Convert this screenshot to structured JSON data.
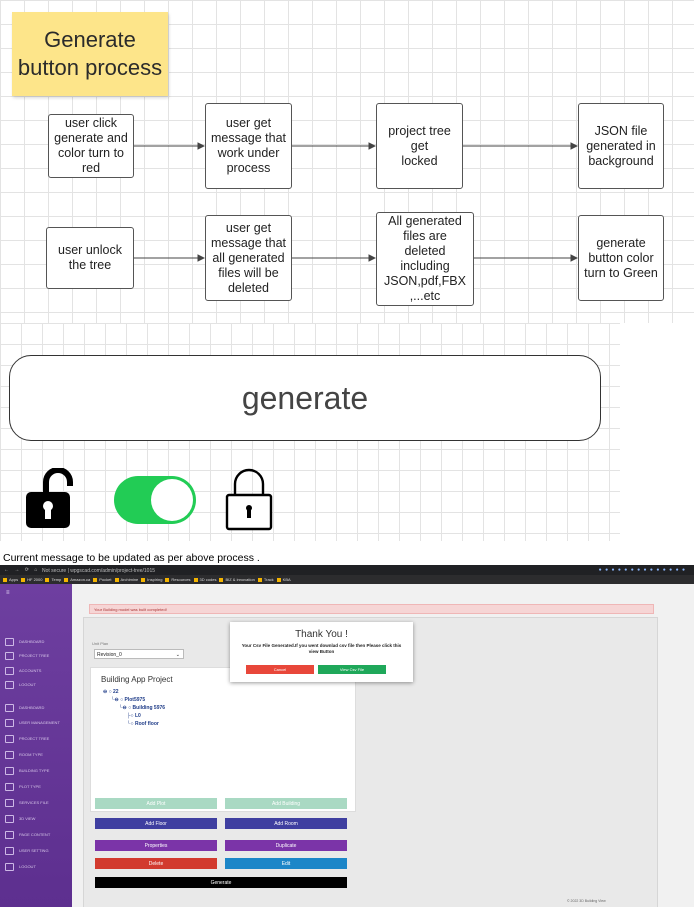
{
  "diagram": {
    "title": "Generate\nbutton process",
    "steps": [
      "user click\ngenerate and\ncolor turn to\nred",
      "user get\nmessage that\nwork under\nprocess",
      "project tree get\nlocked",
      "JSON file\ngenerated in\nbackground"
    ],
    "steps_row2": [
      "user unlock\nthe tree",
      "user get\nmessage that\nall generated\nfiles will be\ndeleted",
      "All generated\nfiles are\ndeleted\nincluding\nJSON,pdf,FBX\n,...etc",
      "generate\nbutton color\nturn to Green"
    ]
  },
  "mock": {
    "button_label": "generate",
    "icons": [
      "unlocked-padlock-icon",
      "toggle-on-icon",
      "locked-padlock-icon"
    ],
    "colors": {
      "toggle": "#22cc55",
      "lock_dark": "#000000"
    }
  },
  "caption": "Current message to be updated as per above process .",
  "screenshot": {
    "url": "Not secure | wpgscad.com/admin/project-tree/1015",
    "bookmarks": [
      "Apps",
      "HF 2000",
      "Temp",
      "Amazon.ca",
      "Pocket",
      "Archimine",
      "Inspiring",
      "Resources",
      "3D codes",
      "BIZ & innovation",
      "Track",
      "KBA"
    ],
    "sidebar_items": [
      "DASHBOARD",
      "PROJECT TREE",
      "ACCOUNTS",
      "LOGOUT",
      "DASHBOARD",
      "USER MANAGEMENT",
      "PROJECT TREE",
      "ROOM TYPE",
      "BUILDING TYPE",
      "PLOT TYPE",
      "SERVICES FILE",
      "3D VIEW",
      "PAGE CONTENT",
      "USER SETTING",
      "LOGOUT"
    ],
    "banner": "Your Building model was built completed!",
    "select_label": "Unit Plan",
    "select_value": "Revision_0",
    "tree_title": "Building App Project",
    "tree_nodes": [
      "22",
      "Plot5975",
      "Building 5976",
      "L0",
      "Roof floor"
    ],
    "buttons": {
      "add_plot": "Add Plot",
      "add_building": "Add Building",
      "add_floor": "Add Floor",
      "add_room": "Add Room",
      "properties": "Properties",
      "duplicate": "Duplicate",
      "delete": "Delete",
      "edit": "Edit",
      "generate": "Generate"
    },
    "modal": {
      "title": "Thank You !",
      "message": "Your Csv File Generated.If you went downlad csv file then Please click this view Button",
      "cancel": "Cancel",
      "view": "View Csv File"
    },
    "footer": "© 2022 3D Building View"
  }
}
